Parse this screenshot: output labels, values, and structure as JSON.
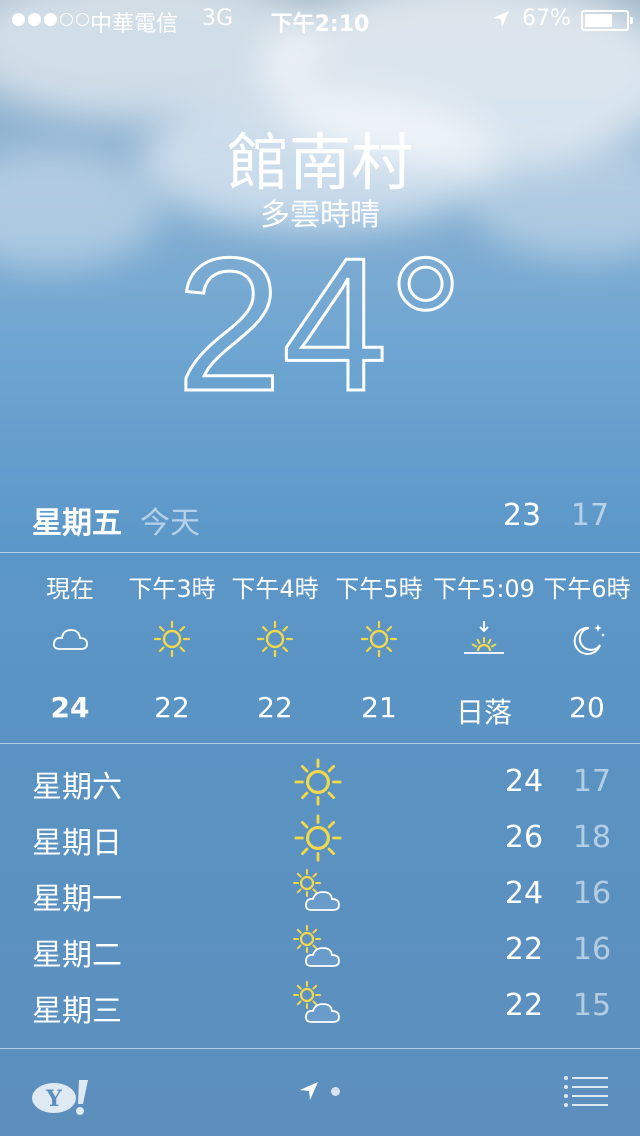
{
  "status_bar": {
    "signal_dots": 3,
    "signal_total": 5,
    "carrier": "中華電信",
    "network": "3G",
    "time": "下午2:10",
    "battery_percent": "67%",
    "battery_level": 0.67,
    "location_icon": "location-arrow-icon"
  },
  "location": {
    "city": "館南村",
    "condition": "多雲時晴",
    "temperature": "24°"
  },
  "today": {
    "day": "星期五",
    "label": "今天",
    "high": "23",
    "low": "17"
  },
  "hourly": [
    {
      "time": "現在",
      "icon": "cloud-icon",
      "temp": "24"
    },
    {
      "time": "下午3時",
      "icon": "sun-icon",
      "temp": "22"
    },
    {
      "time": "下午4時",
      "icon": "sun-icon",
      "temp": "22"
    },
    {
      "time": "下午5時",
      "icon": "sun-icon",
      "temp": "21"
    },
    {
      "time": "下午5:09",
      "icon": "sunset-icon",
      "temp": "日落"
    },
    {
      "time": "下午6時",
      "icon": "moon-stars-icon",
      "temp": "20"
    }
  ],
  "daily": [
    {
      "day": "星期六",
      "icon": "sun-icon",
      "high": "24",
      "low": "17"
    },
    {
      "day": "星期日",
      "icon": "sun-icon",
      "high": "26",
      "low": "18"
    },
    {
      "day": "星期一",
      "icon": "partly-cloudy-icon",
      "high": "24",
      "low": "16"
    },
    {
      "day": "星期二",
      "icon": "partly-cloudy-icon",
      "high": "22",
      "low": "16"
    },
    {
      "day": "星期三",
      "icon": "partly-cloudy-icon",
      "high": "22",
      "low": "15"
    }
  ],
  "bottom_bar": {
    "provider_logo": "yahoo-logo",
    "current_location_icon": "location-arrow-icon",
    "list_icon": "list-icon"
  },
  "colors": {
    "sun": "#f3d94a",
    "text": "#ffffff",
    "muted_text": "rgba(255,255,255,0.55)"
  }
}
